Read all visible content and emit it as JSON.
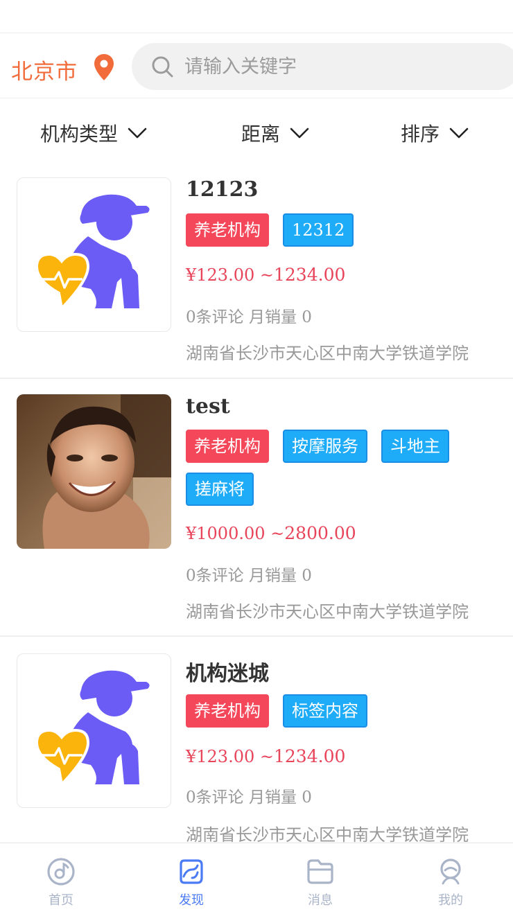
{
  "header": {
    "city": "北京市",
    "search_placeholder": "请输入关键字"
  },
  "filters": [
    {
      "label": "机构类型",
      "icon": "chevron-down-icon"
    },
    {
      "label": "距离",
      "icon": "chevron-down-icon"
    },
    {
      "label": "排序",
      "icon": "chevron-down-icon"
    }
  ],
  "listings": [
    {
      "title": "12123",
      "image": "elderly-care-logo",
      "tags": [
        {
          "text": "养老机构",
          "color": "#f5475a"
        },
        {
          "text": "12312",
          "color": "#1eacf8"
        }
      ],
      "price_min": "¥123.00",
      "price_sep": " ~",
      "price_max": "1234.00",
      "reviews": "0条评论",
      "sales": "月销量 0",
      "address": "湖南省长沙市天心区中南大学铁道学院"
    },
    {
      "title": "test",
      "image": "person-photo",
      "tags": [
        {
          "text": "养老机构",
          "color": "#f5475a"
        },
        {
          "text": "按摩服务",
          "color": "#1eacf8"
        },
        {
          "text": "斗地主",
          "color": "#1eacf8"
        },
        {
          "text": "搓麻将",
          "color": "#1eacf8"
        }
      ],
      "price_min": "¥1000.00",
      "price_sep": " ~",
      "price_max": "2800.00",
      "reviews": "0条评论",
      "sales": "月销量 0",
      "address": "湖南省长沙市天心区中南大学铁道学院"
    },
    {
      "title": "机构迷城",
      "image": "elderly-care-logo",
      "tags": [
        {
          "text": "养老机构",
          "color": "#f5475a"
        },
        {
          "text": "标签内容",
          "color": "#1eacf8"
        }
      ],
      "price_min": "¥123.00",
      "price_sep": " ~",
      "price_max": "1234.00",
      "reviews": "0条评论",
      "sales": "月销量 0",
      "address": "湖南省长沙市天心区中南大学铁道学院"
    }
  ],
  "tabbar": [
    {
      "label": "首页",
      "icon": "home-disc-icon",
      "active": false
    },
    {
      "label": "发现",
      "icon": "discover-icon",
      "active": true
    },
    {
      "label": "消息",
      "icon": "folder-message-icon",
      "active": false
    },
    {
      "label": "我的",
      "icon": "profile-icon",
      "active": false
    }
  ],
  "colors": {
    "accent_city": "#f26b3a",
    "tag_red": "#f5475a",
    "tag_blue": "#1eacf8",
    "price": "#e8445a",
    "tab_active": "#4a7bf5",
    "tab_inactive": "#a9b4c8"
  }
}
